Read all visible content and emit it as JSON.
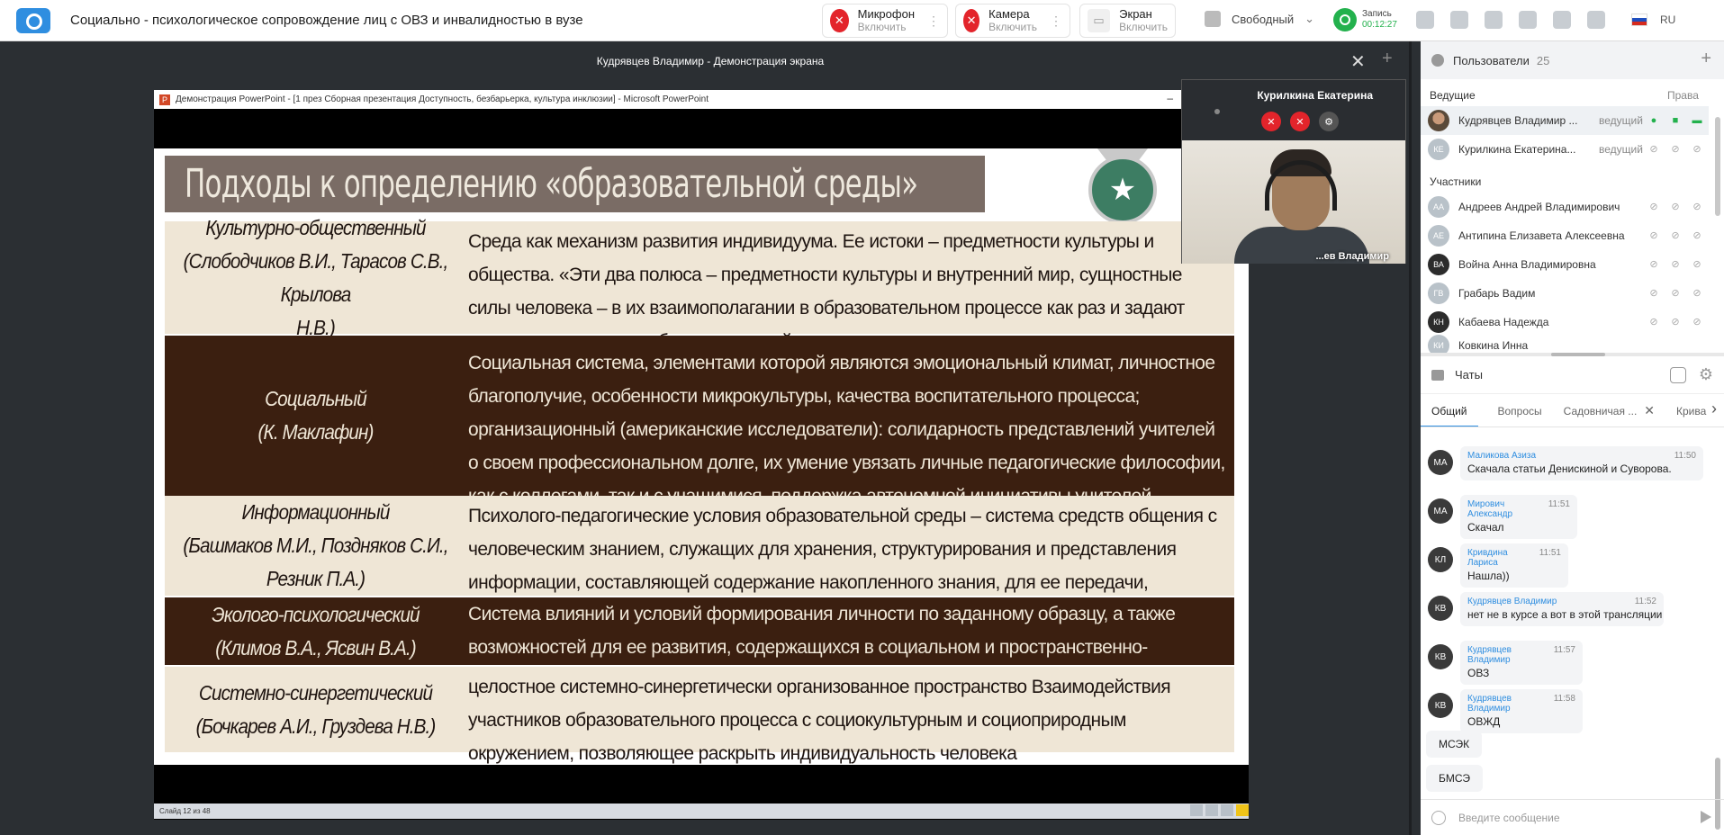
{
  "app": {
    "meeting_title": "Социально - психологическое сопровождение лиц с ОВЗ и инвалидностью в вузе"
  },
  "toolbar": {
    "mic": {
      "label": "Микрофон",
      "action": "Включить"
    },
    "camera": {
      "label": "Камера",
      "action": "Включить"
    },
    "screen": {
      "label": "Экран",
      "action": "Включить"
    },
    "layout": "Свободный",
    "record": {
      "label": "Запись",
      "time": "00:12:27"
    },
    "lang": "RU"
  },
  "share": {
    "title": "Кудрявцев Владимир - Демонстрация экрана",
    "ppt_title": "Демонстрация PowerPoint - [1 през Сборная презентация Доступность, безбарьерка, культура инклюзии] - Microsoft PowerPoint",
    "status": "Слайд 12 из 48"
  },
  "slide": {
    "title": "Подходы к  определению «образовательной среды»",
    "rows": [
      {
        "label": [
          "Культурно-общественный",
          "(Слободчиков В.И., Тарасов С.В., Крылова",
          "Н.В.)"
        ],
        "desc": "Среда как механизм развития индивидуума. Ее истоки – предметности культуры и общества. «Эти два полюса – предметности культуры  и внутренний мир, сущностные силы человека – в их взаимополагании в образовательном процессе как раз и задают границы содержания образовательной среды и ее состав»",
        "style": "light"
      },
      {
        "label": [
          "Социальный",
          "(К. Маклафин)"
        ],
        "desc": "Социальная система, элементами которой являются эмоциональный климат, личностное благополучие, особенности микрокультуры,  качества воспитательного процесса; организационный (американские исследователи): солидарность представлений учителей о своем профессиональном долге, их умение увязать личные педагогические философии, как с коллегами, так и с учащимися, поддержка автономной инициативы учителей администрацией школы",
        "style": "dark"
      },
      {
        "label": [
          "Информационный",
          "(Башмаков М.И., Поздняков С.И., Резник П.А.)"
        ],
        "desc": "Психолого-педагогические условия образовательной среды – система средств общения с человеческим знанием, служащих для хранения, структурирования  и представления информации, составляющей содержание накопленного знания, для ее передачи, переработки и обогащения",
        "style": "light"
      },
      {
        "label": [
          "Эколого-психологический",
          "(Климов В.А., Ясвин В.А.)"
        ],
        "desc": "Система влияний и условий формирования личности по заданному образцу, а также возможностей для ее развития, содержащихся в социальном и пространственно-предметном  окружении",
        "style": "dark"
      },
      {
        "label": [
          "Системно-синергетический",
          "(Бочкарев А.И., Груздева  Н.В.)"
        ],
        "desc": "целостное системно-синергетически организованное пространство Взаимодействия участников образовательного процесса с социокультурным и социоприродным окружением, позволяющее раскрыть индивидуальность человека",
        "style": "light"
      }
    ]
  },
  "video": {
    "name": "Курилкина Екатерина",
    "caption": "...ев Владимир"
  },
  "users": {
    "title": "Пользователи",
    "count": "25",
    "hosts_label": "Ведущие",
    "rights_label": "Права",
    "participants_label": "Участники",
    "hosts": [
      {
        "initials": "",
        "name": "Кудрявцев Владимир ...",
        "role": "ведущий"
      },
      {
        "initials": "КЕ",
        "name": "Курилкина Екатерина...",
        "role": "ведущий"
      }
    ],
    "participants": [
      {
        "initials": "АА",
        "name": "Андреев Андрей Владимирович"
      },
      {
        "initials": "АЕ",
        "name": "Антипина Елизавета Алексеевна"
      },
      {
        "initials": "ВА",
        "name": "Война Анна Владимировна"
      },
      {
        "initials": "ГВ",
        "name": "Грабарь Вадим"
      },
      {
        "initials": "КН",
        "name": "Кабаева Надежда"
      },
      {
        "initials": "КИ",
        "name": "Ковкина Инна"
      }
    ]
  },
  "chats": {
    "title": "Чаты",
    "tabs": [
      "Общий",
      "Вопросы",
      "Садовничая ...",
      "Крива"
    ],
    "messages": [
      {
        "initials": "МА",
        "who": "Маликова Азиза",
        "time": "11:50",
        "text": "Скачала статьи Денискиной и Суворова."
      },
      {
        "initials": "МА",
        "who": "Мирович Александр",
        "time": "11:51",
        "text": "Скачал"
      },
      {
        "initials": "КЛ",
        "who": "Кривдина Лариса",
        "time": "11:51",
        "text": "Нашла))"
      },
      {
        "initials": "КВ",
        "who": "Кудрявцев Владимир",
        "time": "11:52",
        "text": "нет не в курсе а вот в этой трансляции"
      },
      {
        "initials": "КВ",
        "who": "Кудрявцев Владимир",
        "time": "11:57",
        "text": "ОВЗ"
      },
      {
        "initials": "КВ",
        "who": "Кудрявцев Владимир",
        "time": "11:58",
        "text": "ОВЖД"
      }
    ],
    "plain": [
      "МСЭК",
      "БМСЭ"
    ],
    "input_placeholder": "Введите сообщение"
  }
}
